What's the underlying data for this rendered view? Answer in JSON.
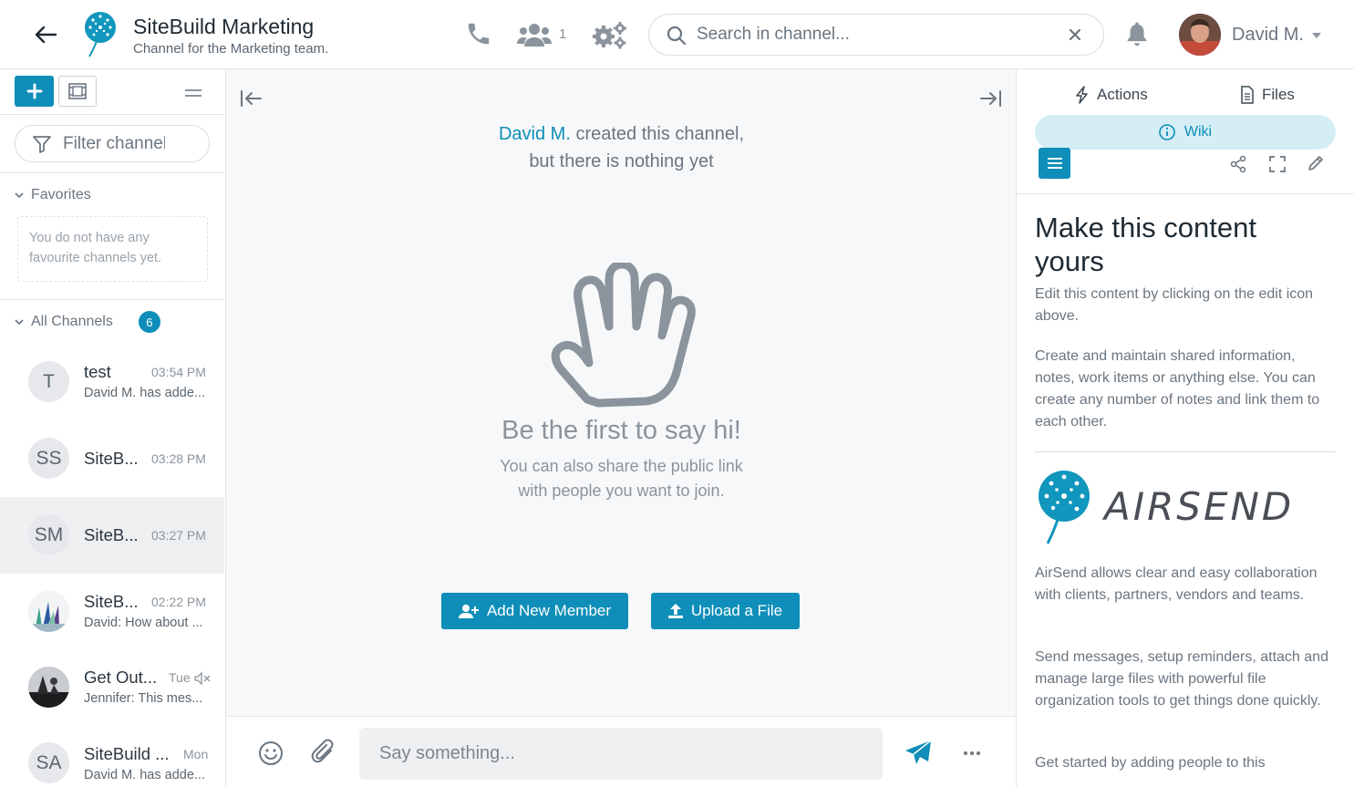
{
  "header": {
    "title": "SiteBuild Marketing",
    "subtitle": "Channel for the Marketing team.",
    "member_count": "1",
    "search_placeholder": "Search in channel...",
    "user_name": "David M."
  },
  "sidebar": {
    "filter_placeholder": "Filter channels",
    "favorites_label": "Favorites",
    "favorites_empty": "You do not have any favourite channels yet.",
    "all_channels_label": "All Channels",
    "all_channels_count": "6",
    "channels": [
      {
        "avatar": "T",
        "name": "test",
        "time": "03:54 PM",
        "preview": "David M. has adde..."
      },
      {
        "avatar": "SS",
        "name": "SiteB...",
        "time": "03:28 PM",
        "preview": ""
      },
      {
        "avatar": "SM",
        "name": "SiteB...",
        "time": "03:27 PM",
        "preview": ""
      },
      {
        "avatar": "",
        "name": "SiteB...",
        "time": "02:22 PM",
        "preview": "David: How about ..."
      },
      {
        "avatar": "",
        "name": "Get Out...",
        "time": "Tue",
        "preview": "Jennifer: This mes..."
      },
      {
        "avatar": "SA",
        "name": "SiteBuild ...",
        "time": "Mon",
        "preview": "David M. has adde..."
      }
    ]
  },
  "main": {
    "created_by": "David M.",
    "created_text": "created this channel,",
    "nothing_yet": "but there is nothing yet",
    "say_hi": "Be the first to say hi!",
    "share_line1": "You can also share the public link",
    "share_line2": "with people you want to join.",
    "add_member_label": "Add New Member",
    "upload_label": "Upload a File",
    "composer_placeholder": "Say something..."
  },
  "right_panel": {
    "tab_actions": "Actions",
    "tab_files": "Files",
    "tab_wiki": "Wiki",
    "wiki_title": "Make this content yours",
    "wiki_p1": "Edit this content by clicking on the edit icon above.",
    "wiki_p2": "Create and maintain shared information, notes, work items or anything else. You can create any number of notes and link them to each other.",
    "airsend_word": "AIRSEND",
    "wiki_p3": "AirSend allows clear and easy collaboration with clients, partners, vendors and teams.",
    "wiki_p4": "Send messages, setup reminders, attach and manage large files with powerful file organization tools to get things done quickly.",
    "wiki_p5": "Get started by adding people to this"
  },
  "colors": {
    "accent": "#0e8eb8",
    "wiki_tab_bg": "#d5eef6",
    "main_bg": "#f7f8f9"
  },
  "icons": [
    "back-arrow-icon",
    "airsend-logo-icon",
    "phone-icon",
    "users-icon",
    "gears-icon",
    "search-icon",
    "clear-icon",
    "bell-icon",
    "plus-icon",
    "dashboard-icon",
    "filter-icon",
    "chevron-down-icon",
    "muted-icon",
    "collapse-left-icon",
    "collapse-right-icon",
    "wave-hand-icon",
    "add-user-icon",
    "upload-icon",
    "emoji-icon",
    "paperclip-icon",
    "send-icon",
    "more-icon",
    "lightning-icon",
    "file-icon",
    "info-icon",
    "menu-icon",
    "share-icon",
    "expand-icon",
    "pencil-icon"
  ]
}
